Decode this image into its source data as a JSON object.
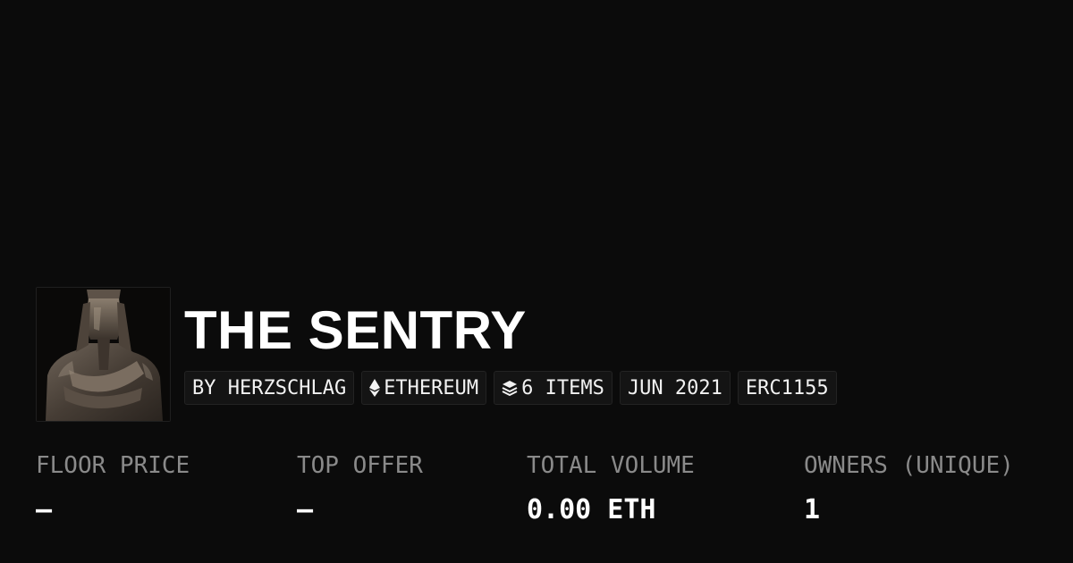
{
  "collection": {
    "title": "THE SENTRY",
    "thumbnail": "statue-image"
  },
  "badges": {
    "creator": "BY HERZSCHLAG",
    "chain": "ETHEREUM",
    "items": "6 ITEMS",
    "date": "JUN 2021",
    "standard": "ERC1155"
  },
  "icons": {
    "chain": "ethereum-icon",
    "items": "layers-icon"
  },
  "stats": {
    "floor_price": {
      "label": "FLOOR PRICE",
      "value": "–"
    },
    "top_offer": {
      "label": "TOP OFFER",
      "value": "–"
    },
    "total_volume": {
      "label": "TOTAL VOLUME",
      "value": "0.00 ETH"
    },
    "owners": {
      "label": "OWNERS (UNIQUE)",
      "value": "1"
    }
  },
  "colors": {
    "background": "#0b0b0b",
    "badge_background": "#141414",
    "label": "#8a8a8a",
    "text": "#ffffff"
  }
}
